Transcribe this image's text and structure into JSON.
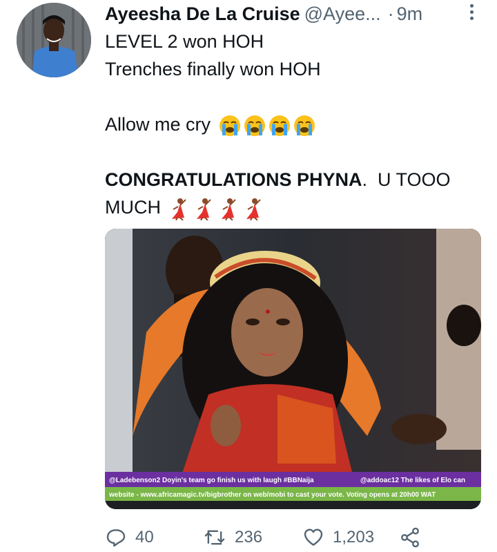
{
  "author": {
    "name": "Ayeesha De La Cruise",
    "handle": "@Ayee...",
    "separator": "·",
    "time": "9m"
  },
  "tweet": {
    "line1": "LEVEL 2 won HOH",
    "line2": "Trenches finally won HOH",
    "line3": "Allow me cry",
    "line4_bold": "CONGRATULATIONS PHYNA",
    "line4_rest": ".  U TOOO",
    "line5": "MUCH",
    "emojis_cry": [
      "loudly-crying-face",
      "loudly-crying-face",
      "loudly-crying-face",
      "loudly-crying-face"
    ],
    "emojis_dance": [
      "woman-dancing",
      "woman-dancing",
      "woman-dancing",
      "woman-dancing"
    ]
  },
  "media": {
    "ticker_line1_left": "@Ladebenson2  Doyin's team go finish us with laugh #BBNaija",
    "ticker_line1_right": "@addoac12  The likes of Elo can",
    "ticker_line2": "website - www.africamagic.tv/bigbrother on web/mobi to cast your vote. Voting opens at 20h00 WAT"
  },
  "actions": {
    "replies": "40",
    "retweets": "236",
    "likes": "1,203"
  },
  "colors": {
    "text": "#0f1419",
    "secondary": "#536471",
    "ticker_purple": "#6b2fa0",
    "ticker_green": "#7ab648"
  }
}
